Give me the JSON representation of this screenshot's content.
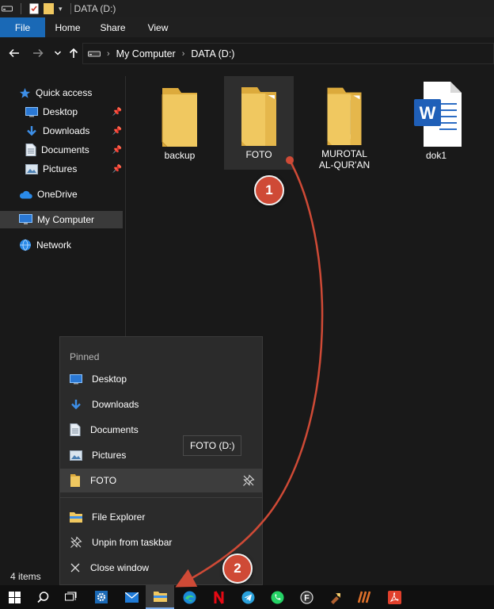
{
  "window": {
    "title": "DATA (D:)"
  },
  "ribbon": {
    "tabs": [
      "File",
      "Home",
      "Share",
      "View"
    ]
  },
  "address": {
    "crumbs": [
      "My Computer",
      "DATA (D:)"
    ]
  },
  "sidebar": {
    "quick_access": "Quick access",
    "items": [
      "Desktop",
      "Downloads",
      "Documents",
      "Pictures"
    ],
    "onedrive": "OneDrive",
    "my_computer": "My Computer",
    "network": "Network"
  },
  "content": {
    "items": [
      {
        "name": "backup",
        "kind": "folder"
      },
      {
        "name": "FOTO",
        "kind": "folder-with-files"
      },
      {
        "name": "MUROTAL\nAL-QUR'AN",
        "kind": "folder-with-files"
      },
      {
        "name": "dok1",
        "kind": "word-document"
      }
    ]
  },
  "status": {
    "count": "4 items"
  },
  "jumplist": {
    "heading": "Pinned",
    "pinned": [
      "Desktop",
      "Downloads",
      "Documents",
      "Pictures",
      "FOTO"
    ],
    "actions": [
      "File Explorer",
      "Unpin from taskbar",
      "Close window"
    ]
  },
  "tooltip": {
    "text": "FOTO (D:)"
  },
  "annotations": {
    "step1": "1",
    "step2": "2",
    "color": "#cf4a36"
  },
  "colors": {
    "accent": "#1a69b6",
    "folder": "#f0c860",
    "folder_dark": "#dcaa3c"
  }
}
